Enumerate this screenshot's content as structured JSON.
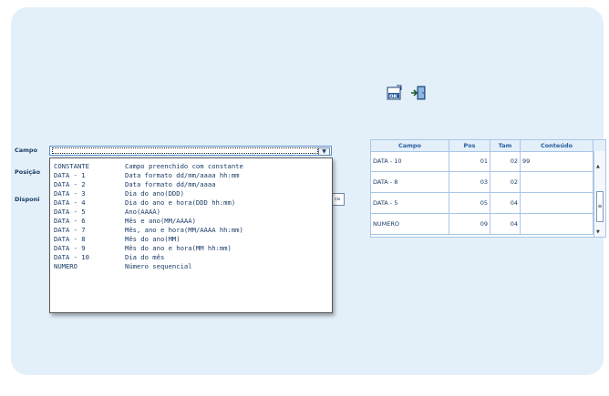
{
  "toolbar": {
    "ok_icon": "ok-confirm-icon",
    "exit_icon": "exit-door-icon"
  },
  "form": {
    "campo_label": "Campo",
    "posicao_label": "Posição",
    "disponivel_label": "Disponi"
  },
  "dropdown": {
    "items": [
      {
        "code": "CONSTANTE",
        "desc": "Campo preenchido com constante"
      },
      {
        "code": "DATA - 1",
        "desc": "Data formato dd/mm/aaaa hh:mm"
      },
      {
        "code": "DATA - 2",
        "desc": "Data formato dd/mm/aaaa"
      },
      {
        "code": "DATA - 3",
        "desc": "Dia do ano(DDD)"
      },
      {
        "code": "DATA - 4",
        "desc": "Dia do ano e hora(DDD hh:mm)"
      },
      {
        "code": "DATA - 5",
        "desc": "Ano(AAAA)"
      },
      {
        "code": "DATA - 6",
        "desc": "Mês e ano(MM/AAAA)"
      },
      {
        "code": "DATA - 7",
        "desc": "Mês, ano e hora(MM/AAAA hh:mm)"
      },
      {
        "code": "DATA - 8",
        "desc": "Mês do ano(MM)"
      },
      {
        "code": "DATA - 9",
        "desc": "Mês do ano e hora(MM hh:mm)"
      },
      {
        "code": "DATA - 10",
        "desc": "Dia do mês"
      },
      {
        "code": "NUMERO",
        "desc": "Número sequencial"
      }
    ]
  },
  "grid": {
    "headers": [
      "Campo",
      "Pos",
      "Tam",
      "Conteúdo"
    ],
    "rows": [
      {
        "campo": "DATA - 10",
        "pos": "01",
        "tam": "02",
        "conteudo": "99"
      },
      {
        "campo": "DATA - 8",
        "pos": "03",
        "tam": "02",
        "conteudo": ""
      },
      {
        "campo": "DATA - 5",
        "pos": "05",
        "tam": "04",
        "conteudo": ""
      },
      {
        "campo": "NUMERO",
        "pos": "09",
        "tam": "04",
        "conteudo": ""
      }
    ]
  }
}
